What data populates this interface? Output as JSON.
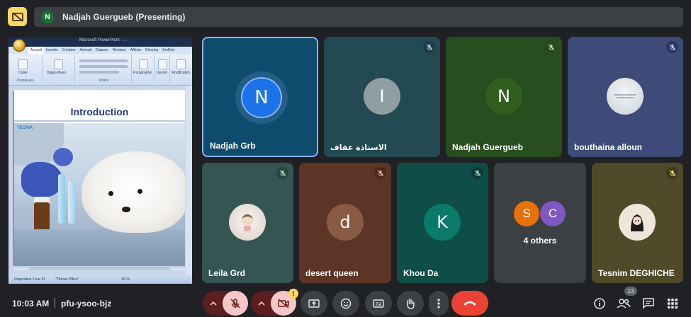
{
  "topbar": {
    "presentation_icon": "presentation-off-icon",
    "presenter_initial": "N",
    "presenter_label": "Nadjah Guergueb (Presenting)"
  },
  "shared_screen": {
    "doc_title": "Microsoft PowerPoint - ...",
    "ribbon_tabs": [
      "Accueil",
      "Insertio",
      "Création",
      "Animati",
      "Diaporo",
      "Révision",
      "Afficha",
      "Dévelop",
      "EndNot"
    ],
    "ribbon_groups": [
      {
        "label": "Presse-pa...",
        "button": "Coller"
      },
      {
        "label": "",
        "button": "Diapositives"
      },
      {
        "label": "Police",
        "button": ""
      },
      {
        "label": "",
        "button": "Paragraphe"
      },
      {
        "label": "",
        "button": "Dessin"
      },
      {
        "label": "",
        "button": "Modification"
      }
    ],
    "slide_title": "Introduction",
    "slide_logo": "TECNIA",
    "status": {
      "slide": "Diapositive 2 sur 31",
      "theme": "\"Thème Office\"",
      "zoom": "60 %"
    }
  },
  "participants": [
    {
      "name": "Nadjah Grb",
      "initial": "N",
      "kind": "letter",
      "bg": "#0e4c6e",
      "avatar_color": "#1a73e8",
      "speaking": true,
      "muted": false
    },
    {
      "name": "الاستاذة عفاف",
      "initial": "I",
      "kind": "letter",
      "bg": "#234a52",
      "avatar_color": "#8f9ea3",
      "muted": true
    },
    {
      "name": "Nadjah Guergueb",
      "initial": "N",
      "kind": "letter",
      "bg": "#284d1f",
      "avatar_color": "#2f5e1e",
      "muted": true
    },
    {
      "name": "bouthaina alloun",
      "initial": "",
      "kind": "image",
      "bg": "#3e4b78",
      "avatar_color": "#d7dde2",
      "muted": true
    },
    {
      "name": "Leila Grd",
      "initial": "",
      "kind": "image",
      "bg": "#355552",
      "avatar_color": "#eae4de",
      "muted": true
    },
    {
      "name": "desert queen",
      "initial": "d",
      "kind": "letter",
      "bg": "#5c3526",
      "avatar_color": "#8a5b44",
      "muted": true
    },
    {
      "name": "Khou Da",
      "initial": "K",
      "kind": "letter",
      "bg": "#0f4d47",
      "avatar_color": "#0b7a6a",
      "muted": true
    },
    {
      "name": "4 others",
      "kind": "group",
      "bg": "#3c4043",
      "others": [
        {
          "initial": "S",
          "color": "#e8710a"
        },
        {
          "initial": "C",
          "color": "#7e57c2"
        }
      ]
    },
    {
      "name": "Tesnim DEGHICHE",
      "initial": "",
      "kind": "image",
      "bg": "#4f4a28",
      "avatar_color": "#e6d9c8",
      "muted": true
    }
  ],
  "bottombar": {
    "time": "10:03 AM",
    "meeting_code": "pfu-ysoo-bjz",
    "camera_warning": "!",
    "people_count": "13",
    "icons": {
      "mic": "mic-off-icon",
      "cam": "videocam-off-icon",
      "present": "present-screen-icon",
      "emoji": "emoji-icon",
      "captions": "captions-icon",
      "hand": "raise-hand-icon",
      "more": "more-options-icon",
      "leave": "leave-call-icon",
      "info": "info-icon",
      "people": "people-icon",
      "chat": "chat-icon",
      "activities": "activities-icon"
    }
  },
  "colors": {
    "background": "#202124",
    "accent_blue": "#8ab4f8",
    "leave_red": "#ea4335",
    "muted_control": "#f6c7c7",
    "warning_yellow": "#fdd663"
  }
}
